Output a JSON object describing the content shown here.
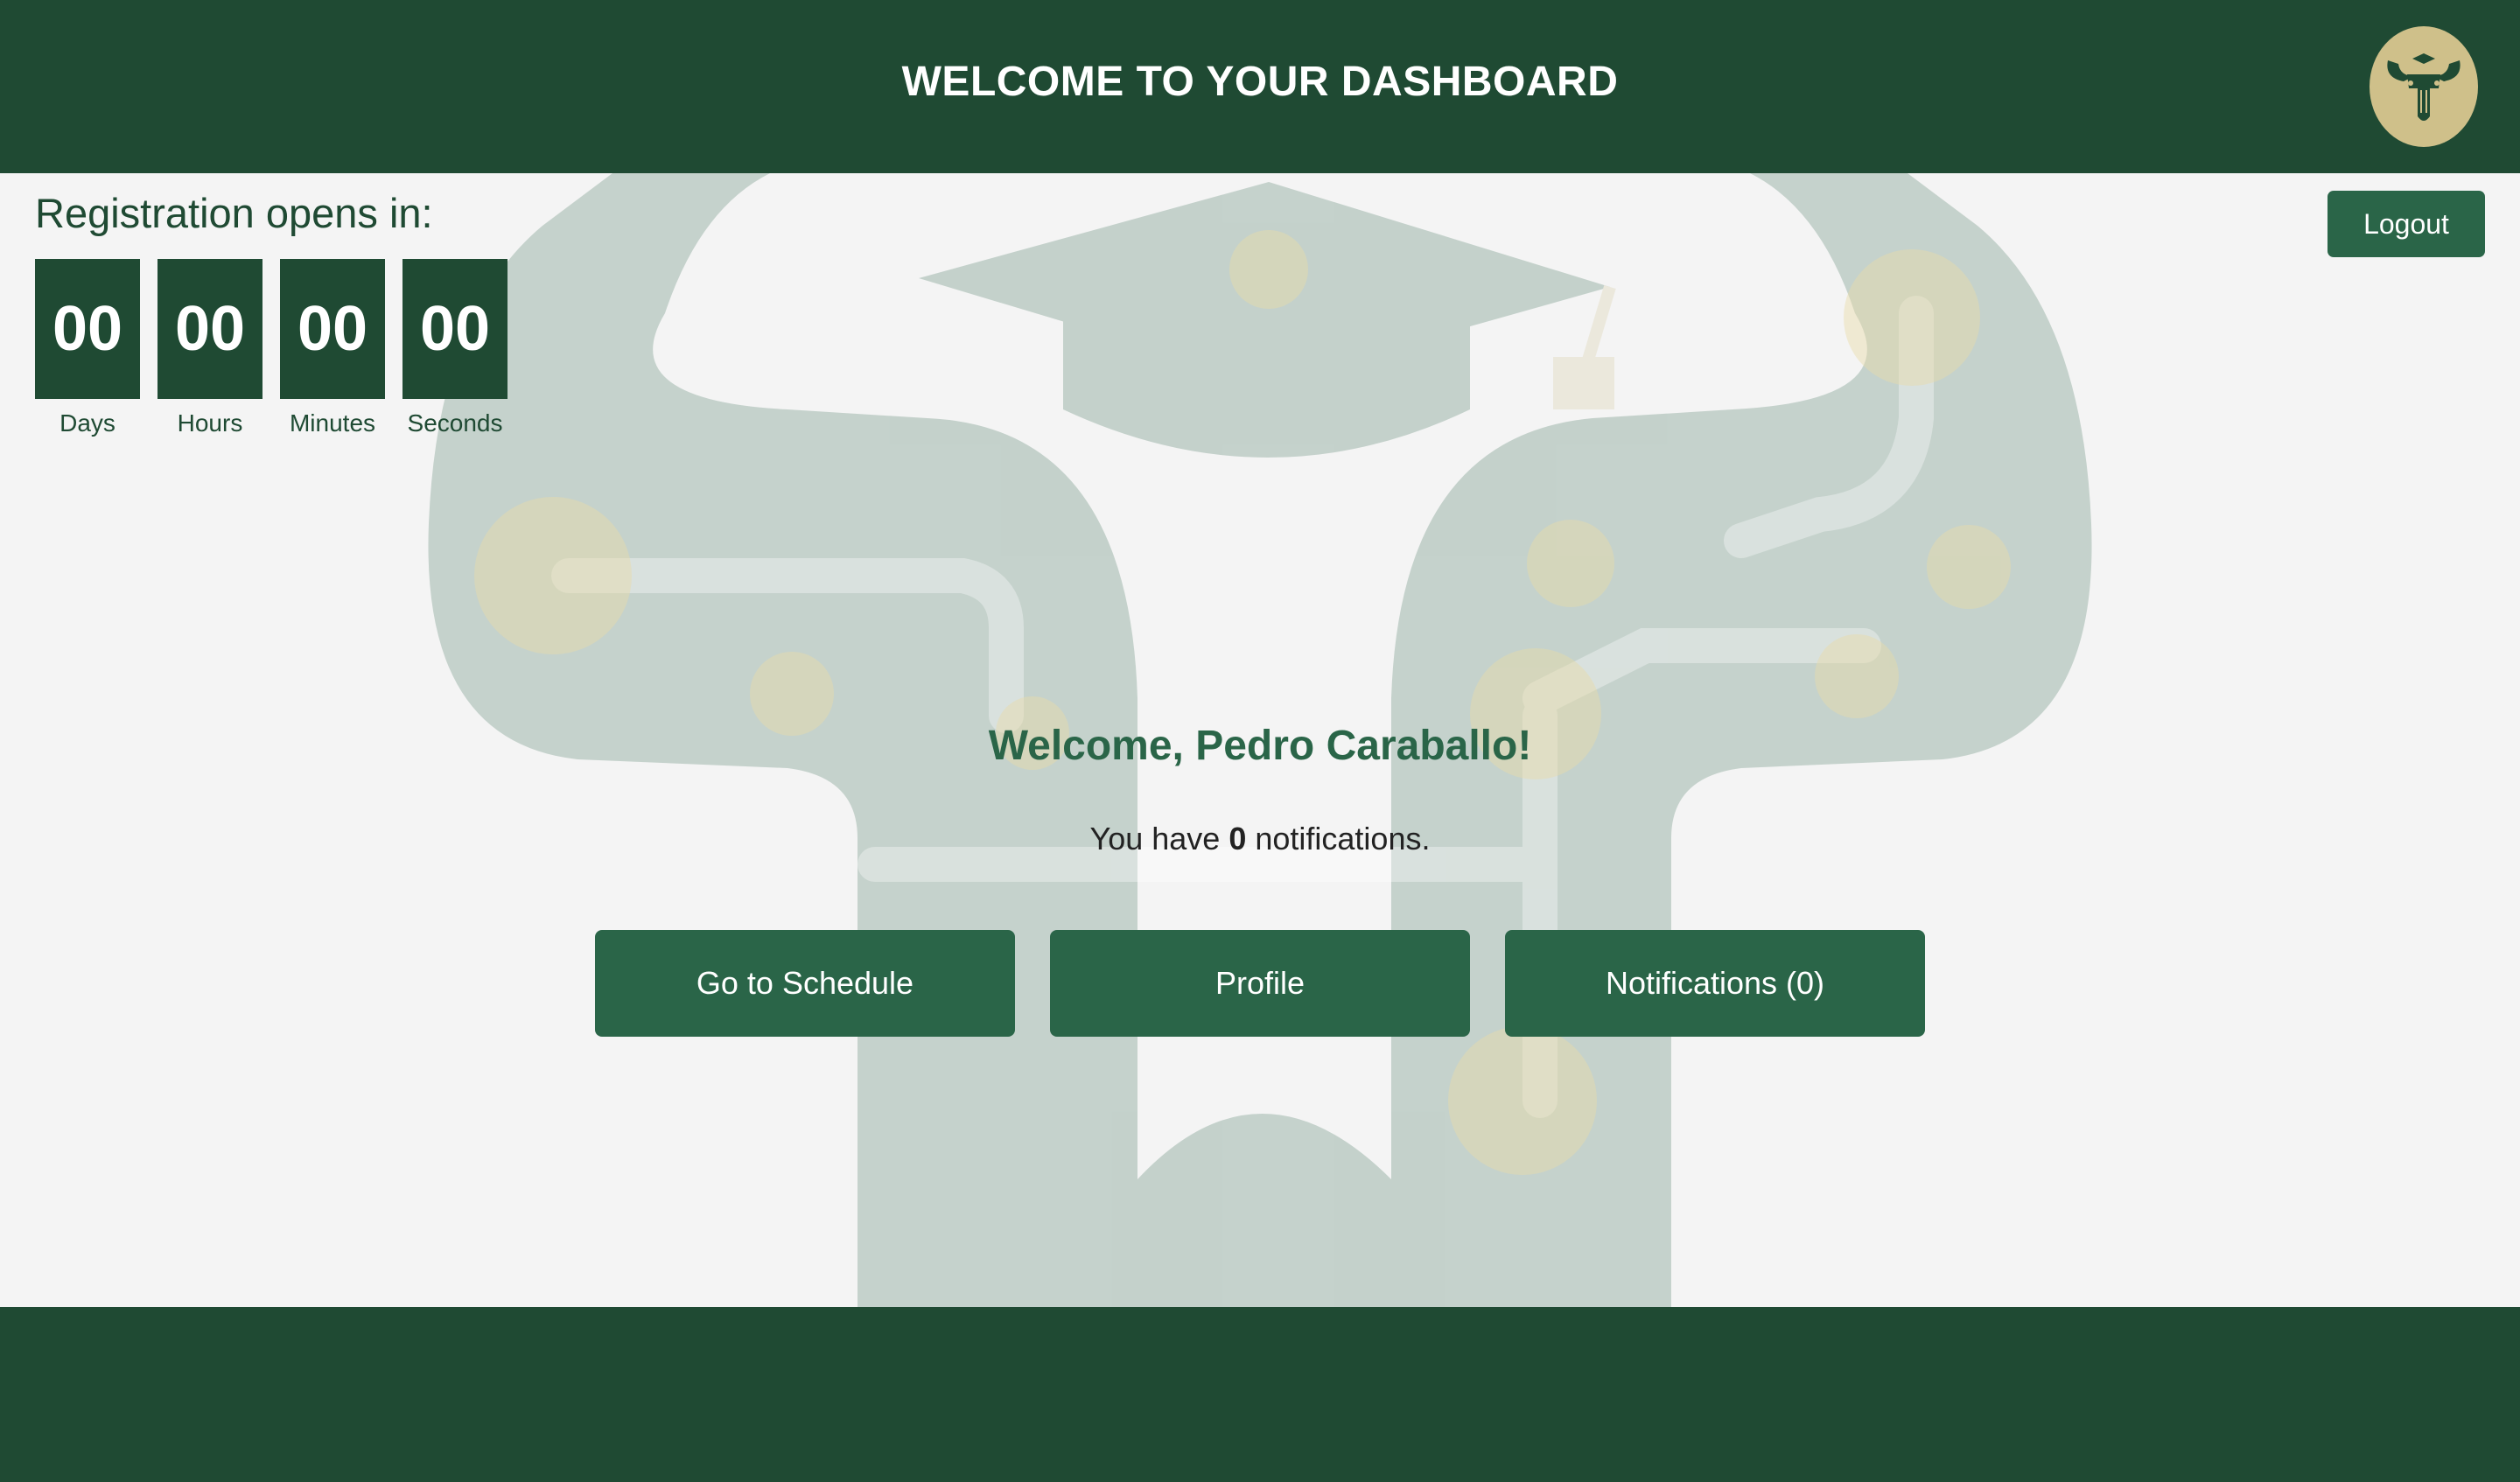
{
  "header": {
    "title": "WELCOME TO YOUR DASHBOARD",
    "logo_icon": "bull-circuit-logo-icon"
  },
  "registration": {
    "title": "Registration opens in:",
    "units": [
      {
        "value": "00",
        "label": "Days"
      },
      {
        "value": "00",
        "label": "Hours"
      },
      {
        "value": "00",
        "label": "Minutes"
      },
      {
        "value": "00",
        "label": "Seconds"
      }
    ]
  },
  "logout_label": "Logout",
  "welcome": {
    "greeting": "Welcome, Pedro Caraballo!",
    "notif_prefix": "You have ",
    "notif_count": "0",
    "notif_suffix": " notifications."
  },
  "buttons": {
    "schedule": "Go to Schedule",
    "profile": "Profile",
    "notifications": "Notifications (0)"
  },
  "colors": {
    "primary_dark": "#1f4a33",
    "primary": "#2a6548",
    "background": "#f4f4f4",
    "accent_gold": "#cfc08a"
  }
}
